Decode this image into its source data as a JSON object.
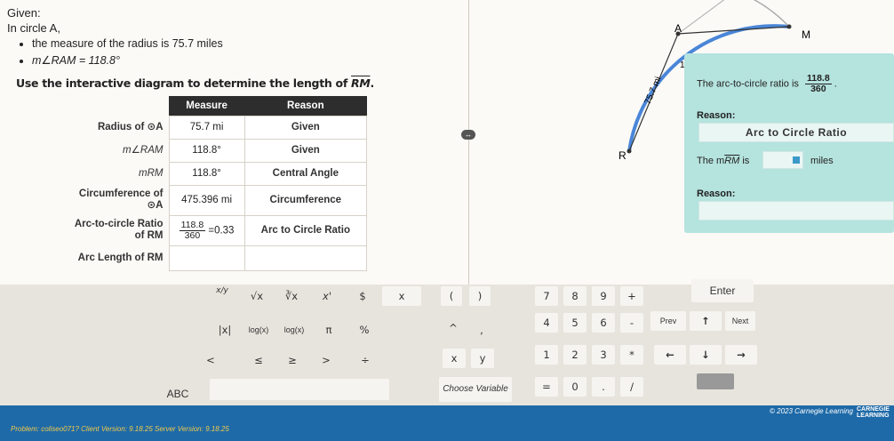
{
  "given": {
    "heading": "Given:",
    "circle": "In circle A,",
    "bullets": [
      "the measure of the radius is 75.7 miles",
      "m∠RAM = 118.8°"
    ]
  },
  "instruction": {
    "prefix": "Use the interactive diagram to determine the length of ",
    "arc": "RM",
    "suffix": "."
  },
  "table": {
    "headers": [
      "Measure",
      "Reason"
    ],
    "rows": [
      {
        "label": "Radius of ⊙A",
        "measure": "75.7 mi",
        "reason": "Given"
      },
      {
        "label": "m∠RAM",
        "measure": "118.8°",
        "reason": "Given"
      },
      {
        "label": "mRM",
        "measure": "118.8°",
        "reason": "Central Angle"
      },
      {
        "label_line1": "Circumference of",
        "label_line2": "⊙A",
        "measure": "475.396 mi",
        "reason": "Circumference"
      },
      {
        "label_line1": "Arc-to-circle Ratio",
        "label_line2": "of RM",
        "measure_num": "118.8",
        "measure_den": "360",
        "measure_tail": "=0.33",
        "reason": "Arc to Circle Ratio"
      },
      {
        "label": "Arc Length of RM",
        "measure": "",
        "reason": ""
      }
    ]
  },
  "diagram": {
    "points": [
      "A",
      "M",
      "R"
    ],
    "radius_label": "75.7 mi",
    "angle_label": "1",
    "ellipsis": "...",
    "arc_color": "#4a86d8"
  },
  "panel": {
    "ratio_prefix": "The arc-to-circle ratio is",
    "ratio_num": "118.8",
    "ratio_den": "360",
    "ratio_suffix": ".",
    "reason1_label": "Reason:",
    "reason1_value": "Arc to Circle Ratio",
    "length_prefix": "The m",
    "length_arc": "RM",
    "length_is": " is",
    "length_unit": "miles",
    "reason2_label": "Reason:",
    "reason2_value": ""
  },
  "keypad": {
    "row1": [
      "x/y",
      "√x",
      "∛x",
      "x'",
      "$",
      "x",
      "(",
      ")",
      "7",
      "8",
      "9",
      "+",
      "Enter"
    ],
    "row2": [
      "|x|",
      "log(x)",
      "log(x)",
      "π",
      "%",
      "^",
      ",",
      "4",
      "5",
      "6",
      "-",
      "Prev",
      "↑",
      "Next"
    ],
    "row3": [
      "<",
      "≤",
      "≥",
      ">",
      "÷",
      "x",
      "y",
      "1",
      "2",
      "3",
      "*",
      "←",
      "↓",
      "→"
    ],
    "row4": [
      "ABC",
      "Choose Variable",
      "=",
      "0",
      ".",
      "/"
    ]
  },
  "footer": {
    "version": "Problem: coliseo071?  Client Version: 9.18.25  Server Version: 9.18.25",
    "copyright": "© 2023 Carnegie Learning",
    "logo": "CARNEGIE LEARNING"
  },
  "colors": {
    "footer": "#1e6aa8",
    "panel": "#b5e3de",
    "arc": "#4a86d8"
  }
}
